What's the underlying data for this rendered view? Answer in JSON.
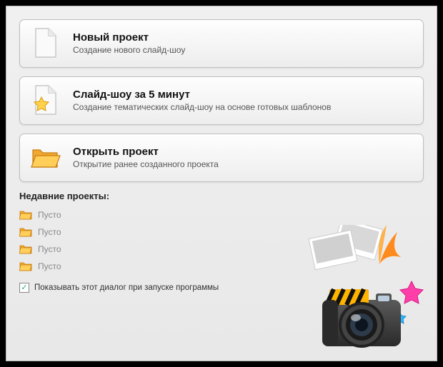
{
  "options": [
    {
      "title": "Новый проект",
      "desc": "Создание нового слайд-шоу",
      "icon": "document"
    },
    {
      "title": "Слайд-шоу за 5 минут",
      "desc": "Создание тематических слайд-шоу на основе готовых шаблонов",
      "icon": "star-document"
    },
    {
      "title": "Открыть проект",
      "desc": "Открытие ранее созданного проекта",
      "icon": "folder"
    }
  ],
  "recent": {
    "header": "Недавние проекты:",
    "items": [
      "Пусто",
      "Пусто",
      "Пусто",
      "Пусто"
    ]
  },
  "checkbox": {
    "checked": true,
    "label": "Показывать этот диалог при запуске программы"
  }
}
